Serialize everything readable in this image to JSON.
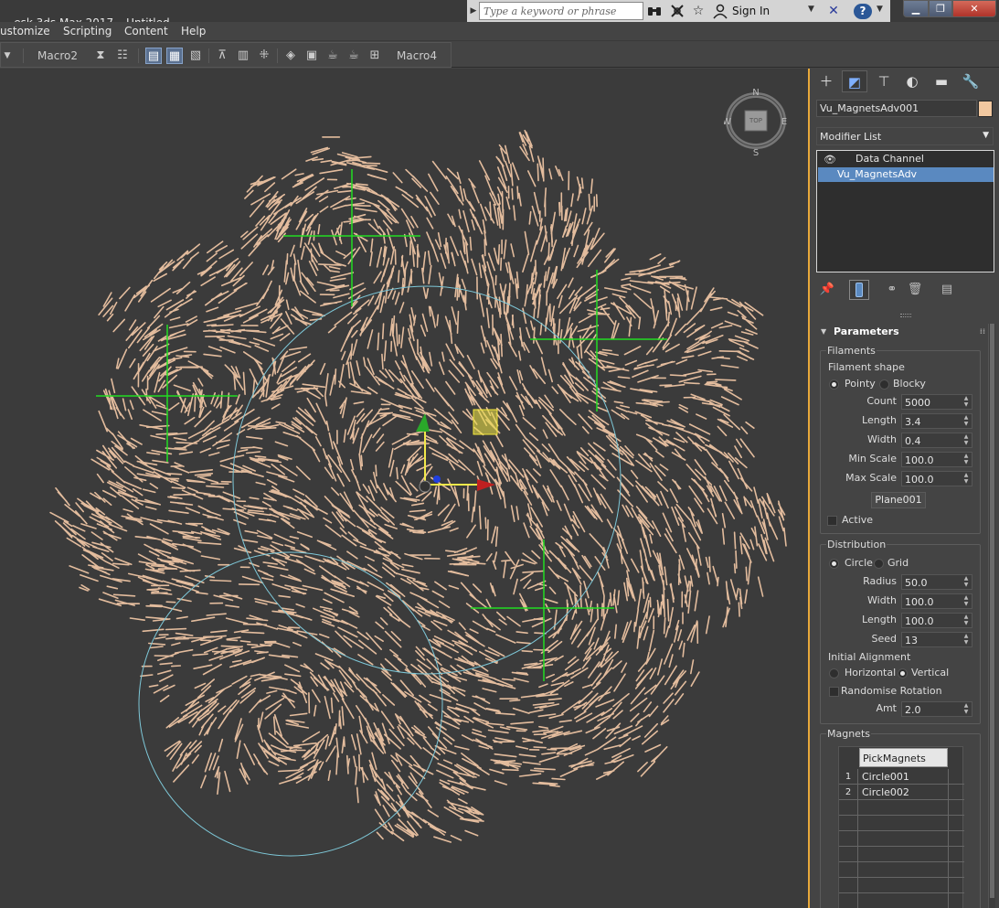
{
  "titlebar": {
    "app": "esk 3ds Max 2017",
    "document": "Untitled",
    "search_placeholder": "Type a keyword or phrase",
    "signin": "Sign In"
  },
  "menu": [
    "ustomize",
    "Scripting",
    "Content",
    "Help"
  ],
  "toolbar": {
    "macro2": "Macro2",
    "macro4": "Macro4"
  },
  "viewport": {
    "viewcube": {
      "n": "N",
      "s": "S",
      "e": "E",
      "w": "W",
      "face": "TOP"
    },
    "filament_color": "#f2c8a6",
    "gizmo_color": "#22dd22",
    "spline_color": "#7ec8d8"
  },
  "panel": {
    "object_name": "Vu_MagnetsAdv001",
    "object_color": "#f2c8a0",
    "modifier_list": "Modifier List",
    "stack": [
      "Data Channel",
      "Vu_MagnetsAdv"
    ],
    "rollout_title": "Parameters",
    "filaments": {
      "title": "Filaments",
      "shape_label": "Filament shape",
      "shape_options": [
        "Pointy",
        "Blocky"
      ],
      "shape_selected": "Pointy",
      "fields": [
        {
          "label": "Count",
          "value": "5000"
        },
        {
          "label": "Length",
          "value": "3.4"
        },
        {
          "label": "Width",
          "value": "0.4"
        },
        {
          "label": "Min Scale",
          "value": "100.0"
        },
        {
          "label": "Max Scale",
          "value": "100.0"
        }
      ],
      "pick_button": "Plane001",
      "active_label": "Active",
      "active_checked": false
    },
    "distribution": {
      "title": "Distribution",
      "options": [
        "Circle",
        "Grid"
      ],
      "selected": "Circle",
      "fields": [
        {
          "label": "Radius",
          "value": "50.0"
        },
        {
          "label": "Width",
          "value": "100.0"
        },
        {
          "label": "Length",
          "value": "100.0"
        },
        {
          "label": "Seed",
          "value": "13"
        }
      ],
      "alignment_label": "Initial Alignment",
      "alignment_options": [
        "Horizontal",
        "Vertical"
      ],
      "alignment_selected": "Vertical",
      "randomise_label": "Randomise Rotation",
      "randomise_checked": false,
      "amt_label": "Amt",
      "amt_value": "2.0"
    },
    "magnets": {
      "title": "Magnets",
      "column": "PickMagnets",
      "rows": [
        {
          "num": "1",
          "name": "Circle001"
        },
        {
          "num": "2",
          "name": "Circle002"
        }
      ]
    }
  }
}
